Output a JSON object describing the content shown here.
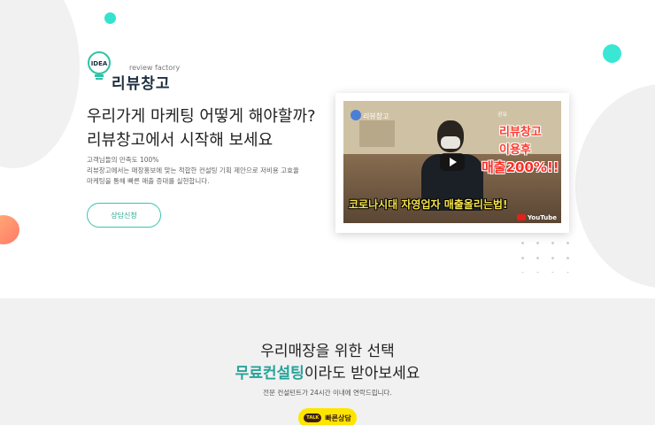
{
  "logo": {
    "tagline": "review factory",
    "name": "리뷰창고",
    "bulb_text": "IDEA"
  },
  "hero": {
    "headline_line1": "우리가게 마케팅 어떻게 해야할까?",
    "headline_line2": "리뷰창고에서 시작해 보세요",
    "desc_line1": "고객님들의 만족도 100%",
    "desc_line2": "리뷰창고에서는 매장홍보에 맞는 적합한 컨설팅 기획 제안으로 저비용 고효율",
    "desc_line3": "마케팅을 통해 빠른 매출 증대를 실현합니다.",
    "consult_button": "상담신청"
  },
  "video": {
    "channel_title": "리뷰창고",
    "share_label": "공유",
    "overlay_line1": "리뷰창고",
    "overlay_line2": "이용후",
    "overlay_line3": "매출200%!!",
    "overlay_bottom": "코로나시대 자영업자 매출올리는법!",
    "youtube_label": "YouTube"
  },
  "section2": {
    "line1": "우리매장을 위한 선택",
    "line2_highlight": "무료컨설팅",
    "line2_rest": "이라도 받아보세요",
    "sub": "전문 컨설턴트가 24시간 이내에 연락드립니다.",
    "kakao_badge": "TALK",
    "kakao_button": "빠른상담"
  },
  "colors": {
    "accent_teal": "#26a39a",
    "kakao_yellow": "#fee500",
    "section_bg": "#f1f1f1"
  }
}
